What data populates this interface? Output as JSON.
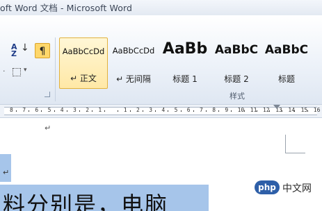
{
  "window": {
    "title": "oft Word 文档  -  Microsoft Word"
  },
  "toolbar": {
    "sort_label": "A",
    "sort_label_z": "Z",
    "paragraph_mark": "¶"
  },
  "styles": {
    "group_label": "样式",
    "items": [
      {
        "sample": "AaBbCcDd",
        "name": "↵ 正文",
        "selected": true
      },
      {
        "sample": "AaBbCcDd",
        "name": "↵ 无间隔",
        "selected": false
      },
      {
        "sample": "AaBb",
        "name": "标题 1",
        "selected": false
      },
      {
        "sample": "AaBbC",
        "name": "标题 2",
        "selected": false
      },
      {
        "sample": "AaBbC",
        "name": "标题",
        "selected": false
      }
    ]
  },
  "ruler": {
    "numbers": [
      "8",
      "7",
      "6",
      "5",
      "4",
      "3",
      "2",
      "1",
      "",
      "1",
      "2",
      "3",
      "4",
      "5",
      "6",
      "7",
      "8",
      "9",
      "10",
      "11",
      "12",
      "13",
      "14",
      "15",
      "16"
    ]
  },
  "document": {
    "para_mark": "↵",
    "selected_text": "料分别是，电脑"
  },
  "watermark": {
    "logo": "php",
    "text": "中文网"
  }
}
